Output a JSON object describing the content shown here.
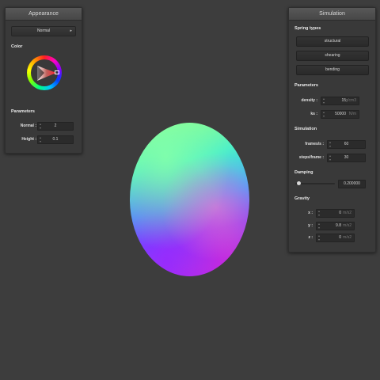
{
  "appearance": {
    "title": "Appearance",
    "mode_select": "Normal",
    "color_label": "Color",
    "parameters_label": "Parameters",
    "normal_label": "Normal :",
    "normal_value": "2",
    "height_label": "Height :",
    "height_value": "0.1"
  },
  "simulation": {
    "title": "Simulation",
    "spring_types_label": "Spring types",
    "spring_buttons": [
      "structural",
      "shearing",
      "bending"
    ],
    "parameters_label": "Parameters",
    "density_label": "density :",
    "density_value": "15",
    "density_unit": "g/cm3",
    "ks_label": "ks :",
    "ks_value": "50000",
    "ks_unit": "N/m",
    "simulation_label": "Simulation",
    "fps_label": "frames/s :",
    "fps_value": "60",
    "steps_label": "steps/frame :",
    "steps_value": "30",
    "damping_label": "Damping",
    "damping_value": "0.200000",
    "damping_level": 0.05,
    "gravity_label": "Gravity",
    "gx_label": "x :",
    "gx_value": "0",
    "gx_unit": "m/s2",
    "gy_label": "y :",
    "gy_value": "9.8",
    "gy_unit": "m/s2",
    "gz_label": "z :",
    "gz_value": "0",
    "gz_unit": "m/s2"
  }
}
